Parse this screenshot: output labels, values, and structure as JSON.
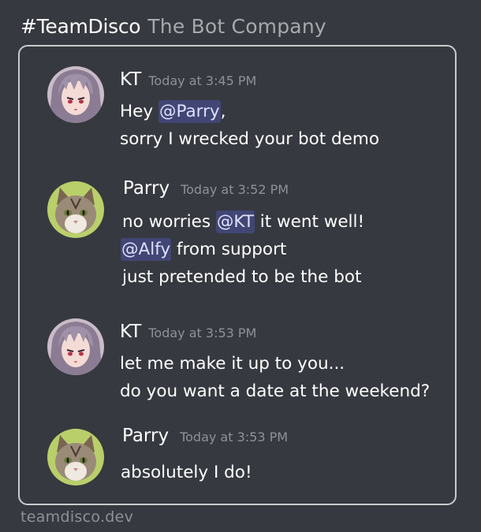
{
  "header": {
    "brand": "#TeamDisco",
    "tagline": "The Bot Company"
  },
  "messages": [
    {
      "author": "KT",
      "timestamp": "Today at 3:45 PM",
      "avatar": "anime-girl-avatar",
      "lines": [
        {
          "pre": "Hey ",
          "mention": "@Parry",
          "post": ","
        },
        {
          "text": "sorry I wrecked your bot demo"
        }
      ]
    },
    {
      "author": "Parry",
      "timestamp": "Today at 3:52 PM",
      "avatar": "cat-avatar",
      "lines": [
        {
          "pre": "no worries ",
          "mention": "@KT",
          "post": " it went well!"
        },
        {
          "mention": "@Alfy",
          "post": " from support"
        },
        {
          "text": "just pretended to be the bot"
        }
      ]
    },
    {
      "author": "KT",
      "timestamp": "Today at 3:53 PM",
      "avatar": "anime-girl-avatar",
      "lines": [
        {
          "text": "let me make it up to you..."
        },
        {
          "text": "do you want a date at the weekend?"
        }
      ]
    },
    {
      "author": "Parry",
      "timestamp": "Today at 3:53 PM",
      "avatar": "cat-avatar",
      "lines": [
        {
          "text": "absolutely I do!"
        }
      ]
    }
  ],
  "footer": {
    "site": "teamdisco.dev"
  },
  "colors": {
    "background": "#36393f",
    "mention_bg": "#414675",
    "mention_text": "#dee0fc",
    "timestamp": "#8e9297"
  }
}
